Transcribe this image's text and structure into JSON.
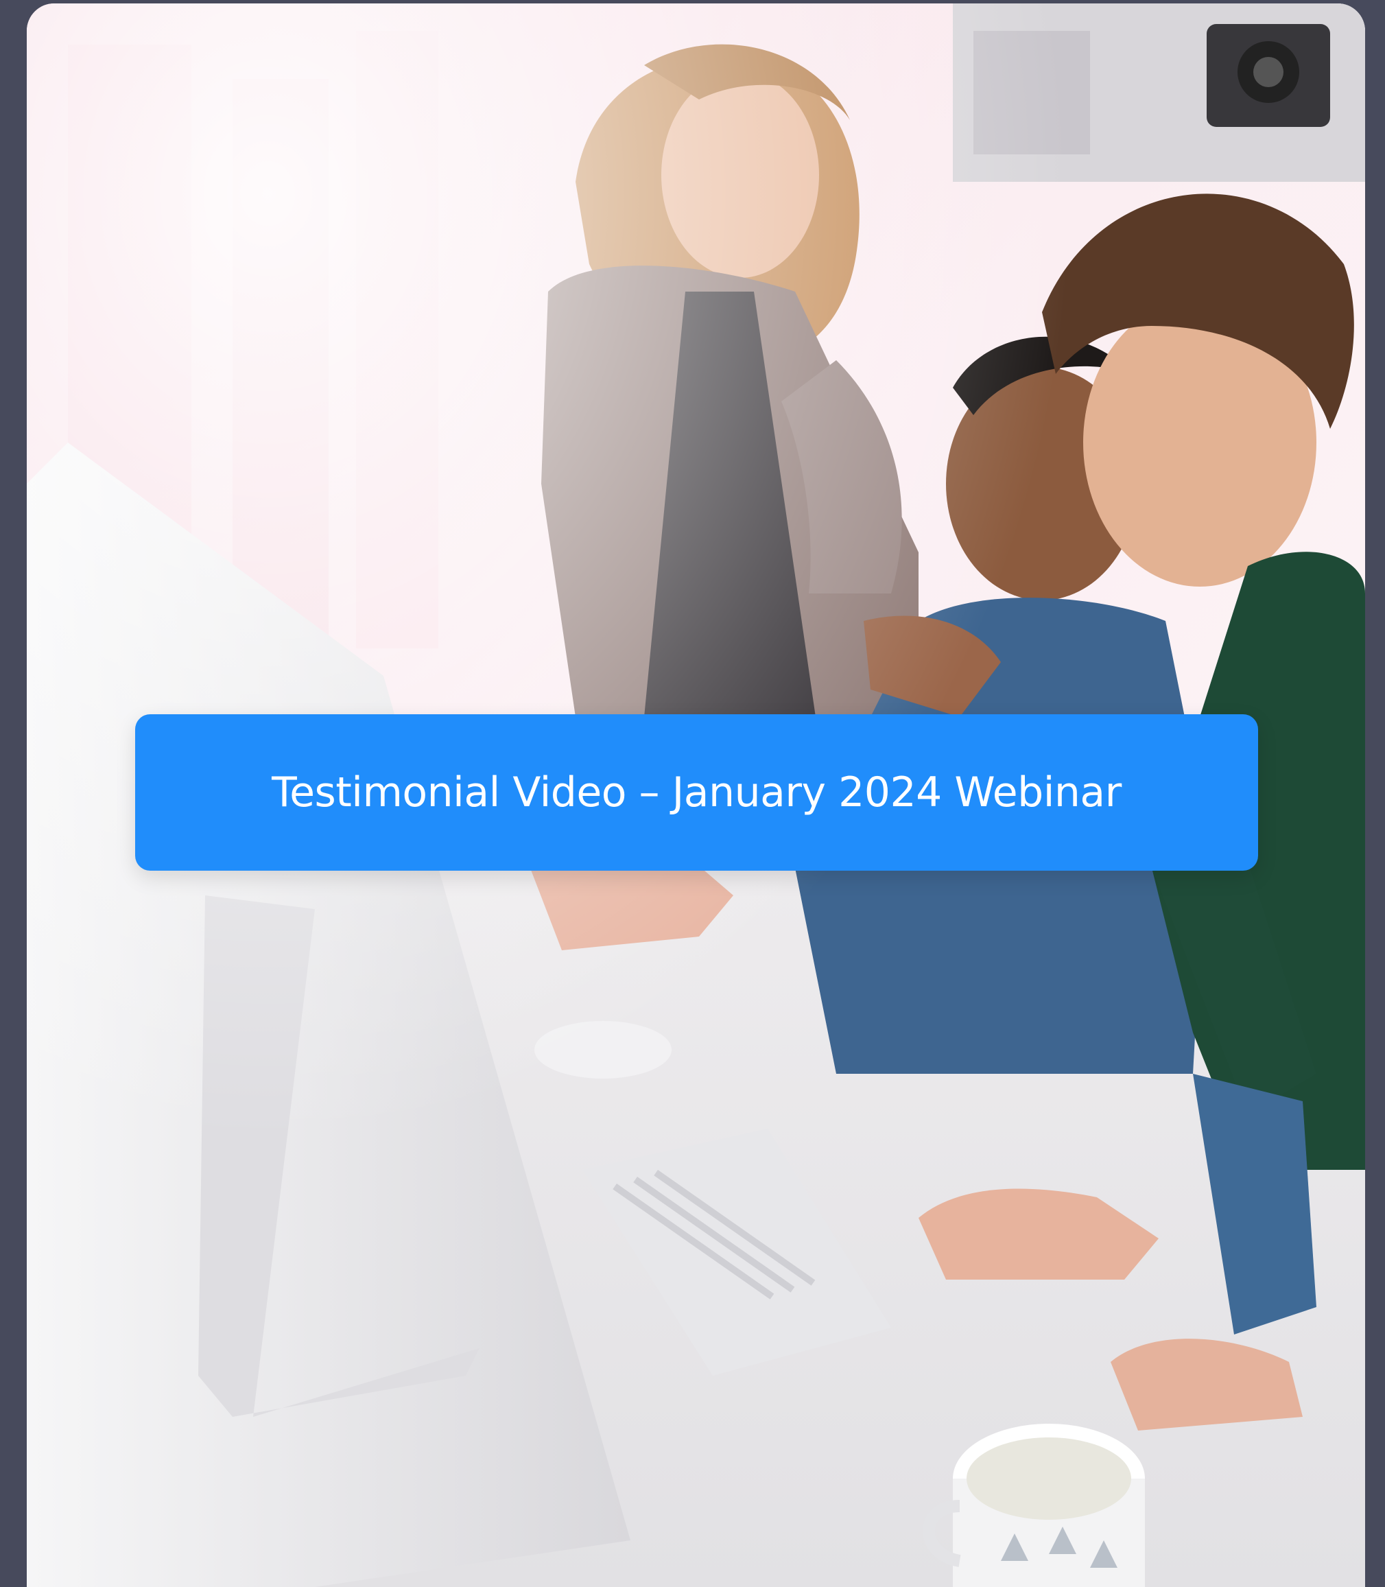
{
  "card": {
    "title": "Testimonial Video – January 2024 Webinar"
  },
  "colors": {
    "page_background": "#474a5c",
    "banner_background": "#208dfb",
    "banner_text": "#ffffff"
  }
}
